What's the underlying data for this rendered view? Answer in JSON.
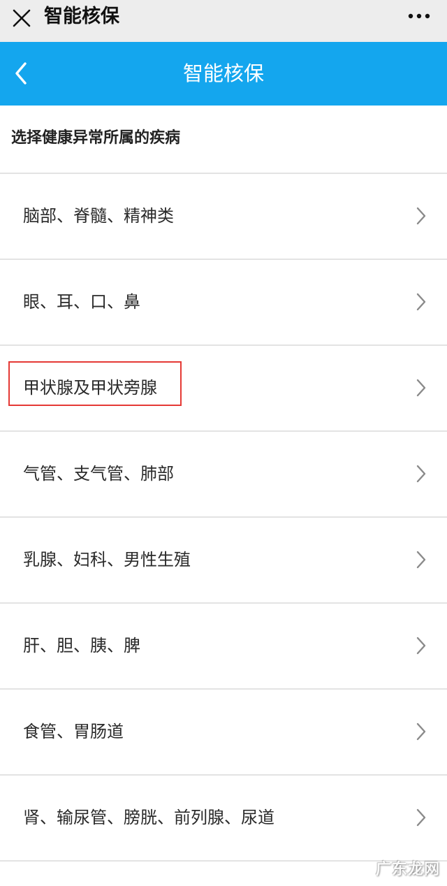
{
  "topbar": {
    "title": "智能核保",
    "close_icon": "close-icon",
    "more_icon": "more-dots-icon"
  },
  "appbar": {
    "title": "智能核保",
    "back_icon": "chevron-left-icon",
    "bg_color": "#14a6ee"
  },
  "section": {
    "title": "选择健康异常所属的疾病"
  },
  "items": [
    {
      "label": "脑部、脊髓、精神类"
    },
    {
      "label": "眼、耳、口、鼻"
    },
    {
      "label": "甲状腺及甲状旁腺",
      "highlighted": true
    },
    {
      "label": "气管、支气管、肺部"
    },
    {
      "label": "乳腺、妇科、男性生殖"
    },
    {
      "label": "肝、胆、胰、脾"
    },
    {
      "label": "食管、胃肠道"
    },
    {
      "label": "肾、输尿管、膀胱、前列腺、尿道"
    }
  ],
  "watermark": {
    "text": "广东龙网"
  }
}
